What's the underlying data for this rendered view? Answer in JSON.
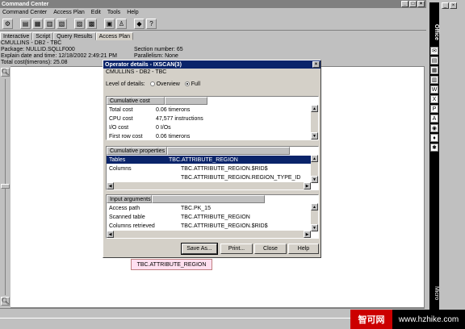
{
  "window": {
    "title": "Command Center",
    "menu": [
      "Command Center",
      "Access Plan",
      "Edit",
      "Tools",
      "Help"
    ],
    "tabs": [
      "Interactive",
      "Script",
      "Query Results",
      "Access Plan"
    ],
    "active_tab": "Access Plan"
  },
  "info": {
    "line1": "CMULLINS - DB2 - TBC",
    "package": "Package: NULLID.SQLLF000",
    "section": "Section number: 65",
    "explain": "Explain date and time: 12/18/2002 2:49:21 PM",
    "parallelism": "Parallelism: None",
    "total_cost": "Total cost(timerons): 25.08"
  },
  "dialog": {
    "title": "Operator details - IXSCAN(3)",
    "subtitle": "CMULLINS - DB2 - TBC",
    "level_label": "Level of details:",
    "overview_label": "Overview",
    "full_label": "Full",
    "selected_level": "Full",
    "cumulative_cost": {
      "header": "Cumulative cost",
      "rows": [
        {
          "label": "Total cost",
          "value": "0.06 timerons"
        },
        {
          "label": "CPU cost",
          "value": "47,577 instructions"
        },
        {
          "label": "I/O cost",
          "value": "0 I/Os"
        },
        {
          "label": "First row cost",
          "value": "0.06 timerons"
        }
      ]
    },
    "cumulative_properties": {
      "header": "Cumulative properties",
      "rows": [
        {
          "label": "Tables",
          "value": "TBC.ATTRIBUTE_REGION"
        },
        {
          "label": "Columns",
          "value": "TBC.ATTRIBUTE_REGION.$RID$"
        },
        {
          "label": "",
          "value": "TBC.ATTRIBUTE_REGION.REGION_TYPE_ID"
        }
      ]
    },
    "input_arguments": {
      "header": "Input arguments",
      "rows": [
        {
          "label": "Access path",
          "value": "TBC.PK_15"
        },
        {
          "label": "Scanned table",
          "value": "TBC.ATTRIBUTE_REGION"
        },
        {
          "label": "Columns retrieved",
          "value": "TBC.ATTRIBUTE_REGION.$RID$"
        }
      ]
    },
    "buttons": {
      "save": "Save As...",
      "print": "Print...",
      "close": "Close",
      "help": "Help"
    }
  },
  "tooltip": "TBC.ATTRIBUTE_REGION",
  "officebar": {
    "office": "Office",
    "microsoft": "Micro"
  },
  "watermark": {
    "left": "智可网",
    "right": "www.hzhike.com"
  }
}
